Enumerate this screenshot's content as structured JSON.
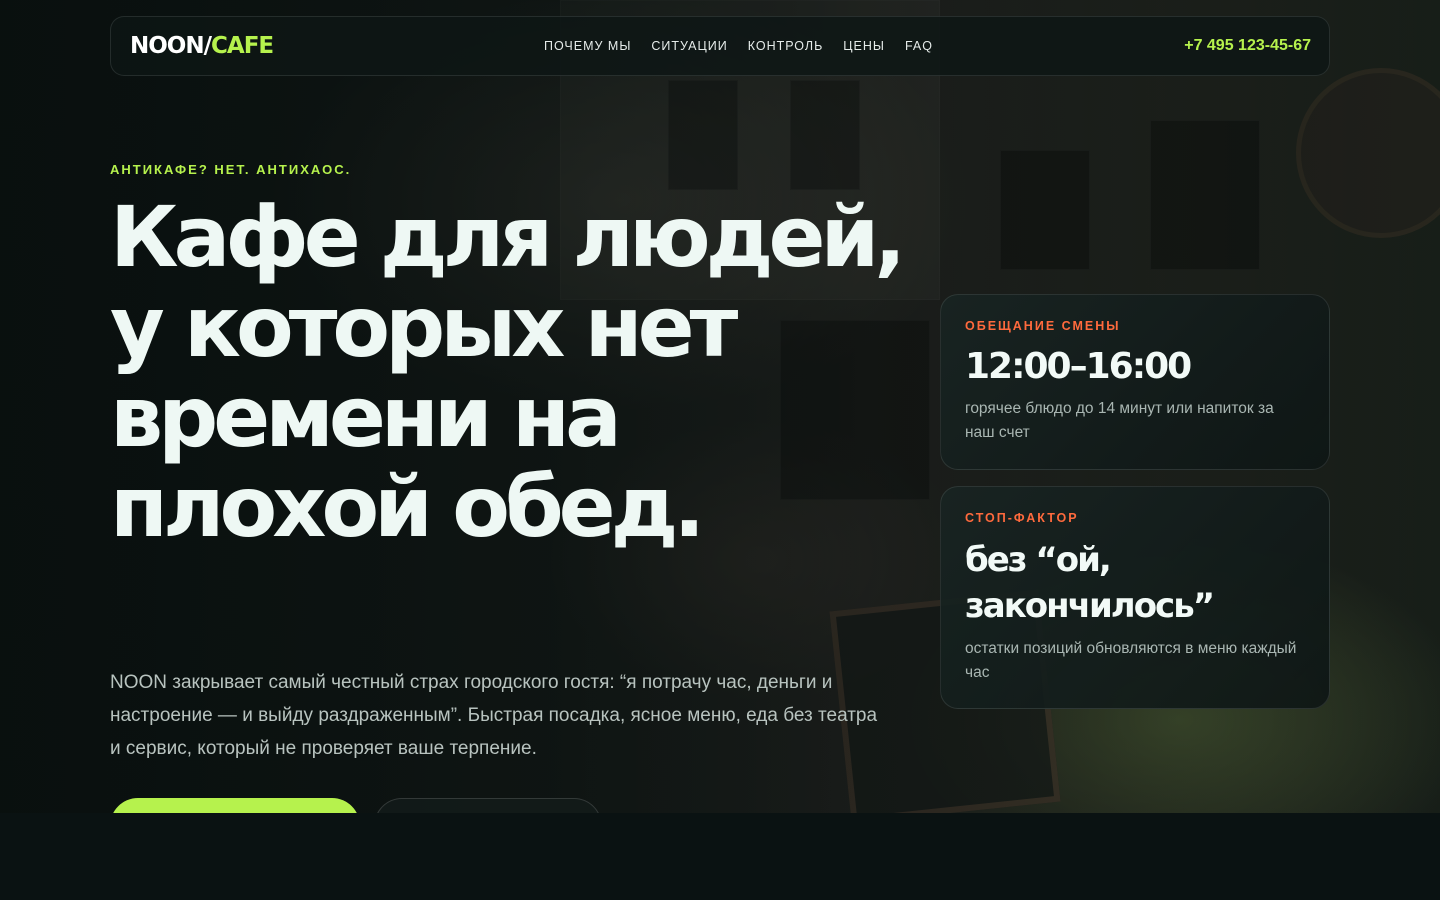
{
  "nav": {
    "logo_main": "NOON/",
    "logo_accent": "CAFE",
    "items": [
      {
        "label": "ПОЧЕМУ МЫ"
      },
      {
        "label": "СИТУАЦИИ"
      },
      {
        "label": "КОНТРОЛЬ"
      },
      {
        "label": "ЦЕНЫ"
      },
      {
        "label": "FAQ"
      }
    ],
    "phone": "+7 495 123-45-67"
  },
  "hero": {
    "eyebrow": "АНТИКАФЕ? НЕТ. АНТИХАОС.",
    "headline": "Кафе для людей, у которых нет времени на плохой обед.",
    "lead": "NOON закрывает самый честный страх городского гостя: “я потрачу час, деньги и настроение — и выйду раздраженным”. Быстрая посадка, ясное меню, еда без театра и сервис, который не проверяет ваше терпение."
  },
  "cards": [
    {
      "label": "ОБЕЩАНИЕ СМЕНЫ",
      "title": "12:00–16:00",
      "desc": "горячее блюдо до 14 минут или напиток за наш счет"
    },
    {
      "label": "СТОП-ФАКТОР",
      "title": "без “ой, закончилось”",
      "desc": "остатки позиций обновляются в меню каждый час"
    }
  ],
  "colors": {
    "accent": "#b6f24d",
    "label_orange": "#ff6a3d",
    "background": "#0a1212"
  }
}
